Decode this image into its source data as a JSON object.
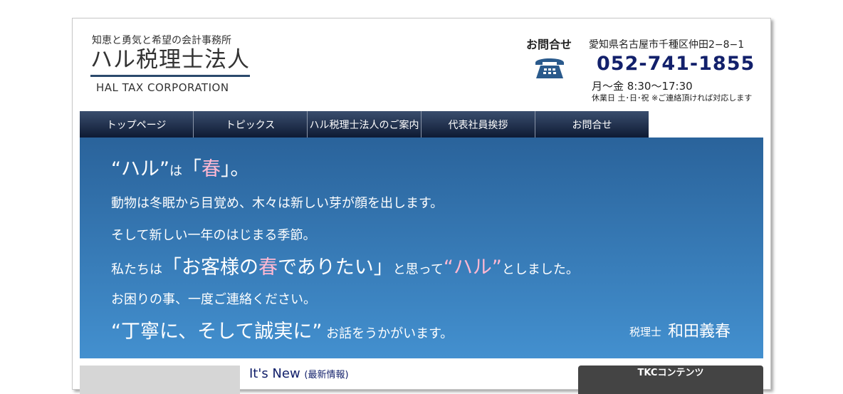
{
  "header": {
    "tagline": "知恵と勇気と希望の会計事務所",
    "logo": "ハル税理士法人",
    "logo_en": "HAL TAX CORPORATION"
  },
  "contact": {
    "title": "お問合せ",
    "address": "愛知県名古屋市千種区仲田2−8−1",
    "tel": "052-741-1855",
    "hours": "月〜金 8:30〜17:30",
    "holiday": "休業日 土･日･祝 ※ご連絡頂ければ対応します"
  },
  "nav": {
    "items": [
      {
        "label": "トップページ"
      },
      {
        "label": "トピックス"
      },
      {
        "label": "ハル税理士法人のご案内"
      },
      {
        "label": "代表社員挨拶"
      },
      {
        "label": "お問合せ"
      }
    ]
  },
  "hero": {
    "l1a": "“ハル”",
    "l1b": "は",
    "l1c": "「",
    "l1d": "春",
    "l1e": "」。",
    "l2": "動物は冬眠から目覚め、木々は新しい芽が顔を出します。",
    "l3": "そして新しい一年のはじまる季節。",
    "l4a": "私たちは",
    "l4b": "「お客様の",
    "l4c": "春",
    "l4d": "でありたい」",
    "l4e": "と思って",
    "l4f": "“ハル”",
    "l4g": "としました。",
    "l5": "お困りの事、一度ご連絡ください。",
    "l6a": "“丁寧に、そして誠実に”",
    "l6b": " お話をうかがいます。",
    "sig_title": "税理士",
    "sig_name": "和田義春"
  },
  "news": {
    "title": "It's New",
    "subtitle": "(最新情報)"
  },
  "tkc": {
    "title": "TKCコンテンツ"
  },
  "colors": {
    "nav_bg": "#1c2a45",
    "hero_top": "#2a639b",
    "hero_bottom": "#4390cf",
    "tel": "#12206b",
    "accent_pink": "#ffb8d2"
  }
}
